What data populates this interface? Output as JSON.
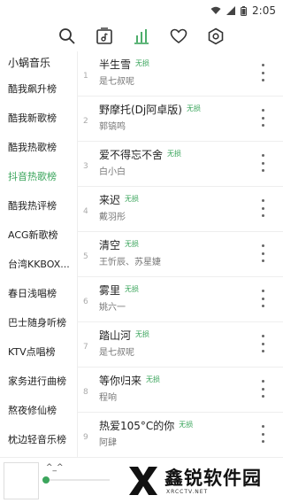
{
  "status": {
    "time": "2:05"
  },
  "toolbar": {
    "icons": [
      "search-icon",
      "playlist-icon",
      "chart-bars-icon",
      "heart-icon",
      "settings-hex-icon"
    ],
    "active_color": "#3ba55c"
  },
  "sidebar": {
    "title": "小蜗音乐",
    "items": [
      {
        "label": "酷我飙升榜"
      },
      {
        "label": "酷我新歌榜"
      },
      {
        "label": "酷我热歌榜"
      },
      {
        "label": "抖音热歌榜"
      },
      {
        "label": "酷我热评榜"
      },
      {
        "label": "ACG新歌榜"
      },
      {
        "label": "台湾KKBOX..."
      },
      {
        "label": "春日浅唱榜"
      },
      {
        "label": "巴士随身听榜"
      },
      {
        "label": "KTV点唱榜"
      },
      {
        "label": "家务进行曲榜"
      },
      {
        "label": "熬夜修仙榜"
      },
      {
        "label": "枕边轻音乐榜"
      }
    ],
    "active_index": 3
  },
  "songs": [
    {
      "num": "1",
      "title": "半生雪",
      "badge": "无损",
      "artist": "是七叔呢"
    },
    {
      "num": "2",
      "title": "野摩托(Dj阿卓版)",
      "badge": "无损",
      "artist": "郭镐鸣"
    },
    {
      "num": "3",
      "title": "爱不得忘不舍",
      "badge": "无损",
      "artist": "白小白"
    },
    {
      "num": "4",
      "title": "来迟",
      "badge": "无损",
      "artist": "戴羽彤"
    },
    {
      "num": "5",
      "title": "清空",
      "badge": "无损",
      "artist": "王忻辰、苏星婕"
    },
    {
      "num": "6",
      "title": "雾里",
      "badge": "无损",
      "artist": "姚六一"
    },
    {
      "num": "7",
      "title": "踏山河",
      "badge": "无损",
      "artist": "是七叔呢"
    },
    {
      "num": "8",
      "title": "等你归来",
      "badge": "无损",
      "artist": "程响"
    },
    {
      "num": "9",
      "title": "热爱105°C的你",
      "badge": "无损",
      "artist": "阿肆"
    }
  ],
  "player": {
    "label": "^_^",
    "progress": 0
  },
  "watermark": {
    "cn": "鑫锐软件园",
    "en": "XRCCTV.NET"
  }
}
